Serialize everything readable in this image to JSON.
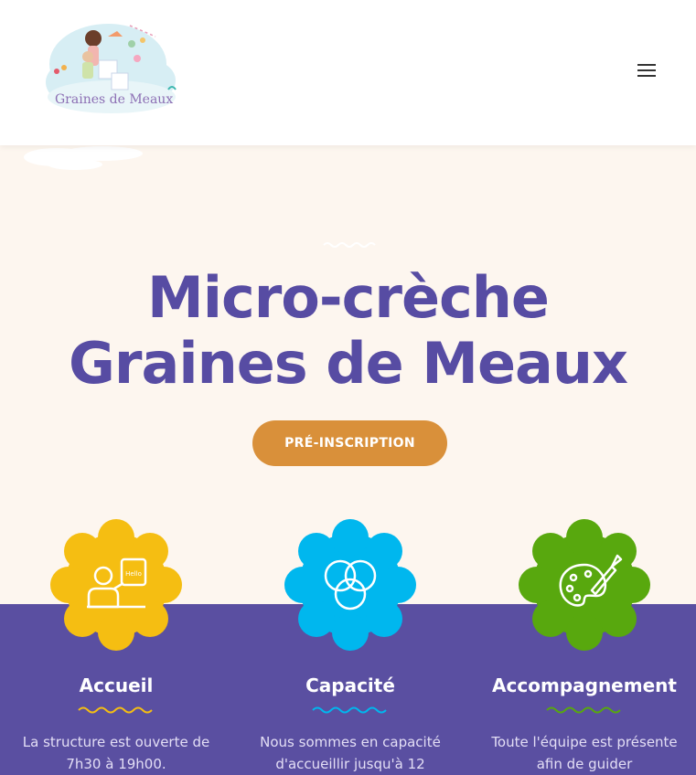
{
  "header": {
    "logo_text": "Graines de Meaux",
    "menu_icon": "hamburger-menu-icon"
  },
  "hero": {
    "title_line1": "Micro-crèche",
    "title_line2": "Graines de Meaux",
    "cta_label": "PRÉ-INSCRIPTION"
  },
  "features": [
    {
      "title": "Accueil",
      "text": "La structure est ouverte de 7h30 à 19h00.",
      "icon": "teacher-hello-icon",
      "color": "#f5be12",
      "wave_color": "#f5be12"
    },
    {
      "title": "Capacité",
      "text": "Nous sommes en capacité d'accueillir jusqu'à 12",
      "icon": "venn-circles-icon",
      "color": "#00b7ee",
      "wave_color": "#00b7ee"
    },
    {
      "title": "Accompagnement",
      "text": "Toute l'équipe est présente afin de guider",
      "icon": "palette-brush-icon",
      "color": "#58a80e",
      "wave_color": "#58a80e"
    }
  ],
  "colors": {
    "hero_bg": "#fdf6ef",
    "title": "#574ca3",
    "cta": "#d9903a",
    "band": "#5a4fa1"
  }
}
